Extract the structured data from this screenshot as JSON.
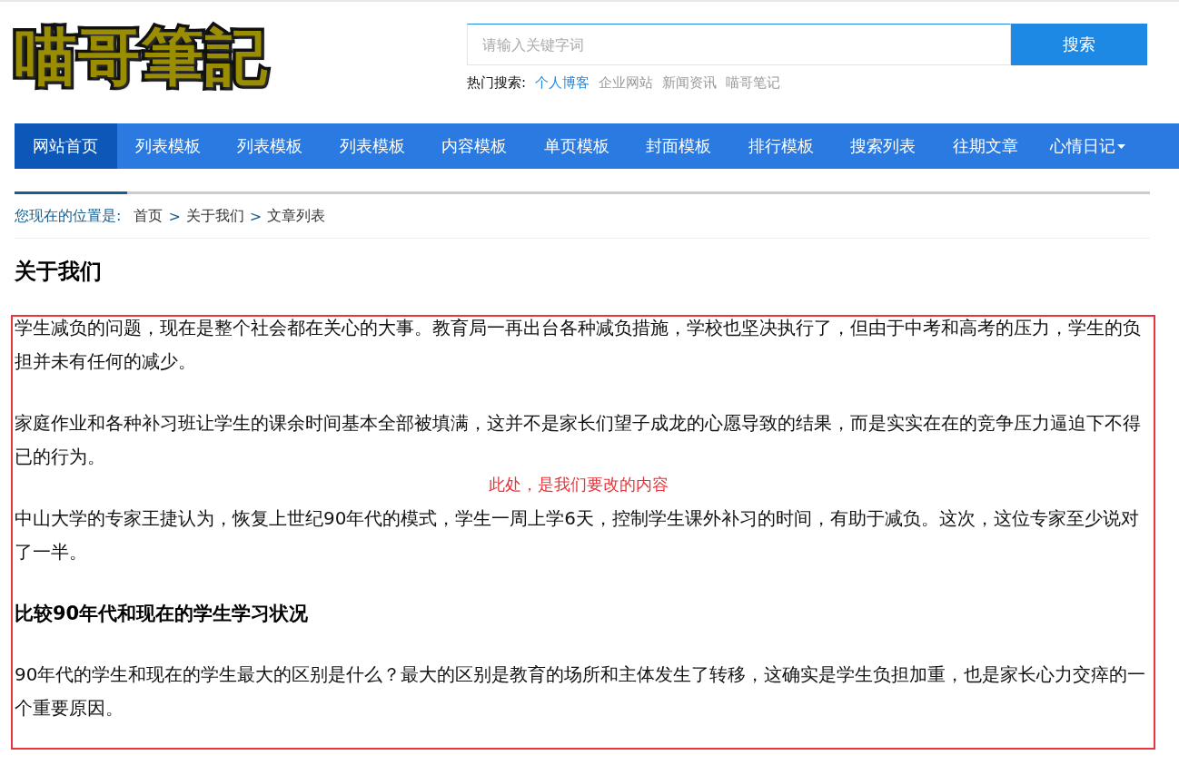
{
  "logo": {
    "text": "喵哥筆記"
  },
  "search": {
    "placeholder": "请输入关键字词",
    "button": "搜索"
  },
  "hot_search": {
    "label": "热门搜索:",
    "links": [
      {
        "text": "个人博客",
        "color": "#1e88e5"
      },
      {
        "text": "企业网站",
        "color": "#999999"
      },
      {
        "text": "新闻资讯",
        "color": "#999999"
      },
      {
        "text": "喵哥笔记",
        "color": "#999999"
      }
    ]
  },
  "nav": [
    {
      "label": "网站首页",
      "selected": true,
      "dropdown": false
    },
    {
      "label": "列表模板",
      "selected": false,
      "dropdown": false
    },
    {
      "label": "列表模板",
      "selected": false,
      "dropdown": false
    },
    {
      "label": "列表模板",
      "selected": false,
      "dropdown": false
    },
    {
      "label": "内容模板",
      "selected": false,
      "dropdown": false
    },
    {
      "label": "单页模板",
      "selected": false,
      "dropdown": false
    },
    {
      "label": "封面模板",
      "selected": false,
      "dropdown": false
    },
    {
      "label": "排行模板",
      "selected": false,
      "dropdown": false
    },
    {
      "label": "搜索列表",
      "selected": false,
      "dropdown": false
    },
    {
      "label": "往期文章",
      "selected": false,
      "dropdown": false
    },
    {
      "label": "心情日记",
      "selected": false,
      "dropdown": true
    }
  ],
  "breadcrumb": {
    "label": "您现在的位置是:",
    "items": [
      "首页",
      "关于我们",
      "文章列表"
    ],
    "separator": ">"
  },
  "title": "关于我们",
  "content": [
    {
      "kind": "paragraph",
      "text": "学生减负的问题，现在是整个社会都在关心的大事。教育局一再出台各种减负措施，学校也坚决执行了，但由于中考和高考的压力，学生的负担并未有任何的减少。"
    },
    {
      "kind": "paragraph",
      "text": "家庭作业和各种补习班让学生的课余时间基本全部被填满，这并不是家长们望子成龙的心愿导致的结果，而是实实在在的竞争压力逼迫下不得已的行为。"
    },
    {
      "kind": "paragraph",
      "text": "中山大学的专家王捷认为，恢复上世纪90年代的模式，学生一周上学6天，控制学生课外补习的时间，有助于减负。这次，这位专家至少说对了一半。"
    },
    {
      "kind": "heading",
      "text": "比较90年代和现在的学生学习状况"
    },
    {
      "kind": "paragraph",
      "text": "90年代的学生和现在的学生最大的区别是什么？最大的区别是教育的场所和主体发生了转移，这确实是学生负担加重，也是家长心力交瘁的一个重要原因。"
    }
  ],
  "annotation": {
    "text": "此处，是我们要改的内容"
  }
}
